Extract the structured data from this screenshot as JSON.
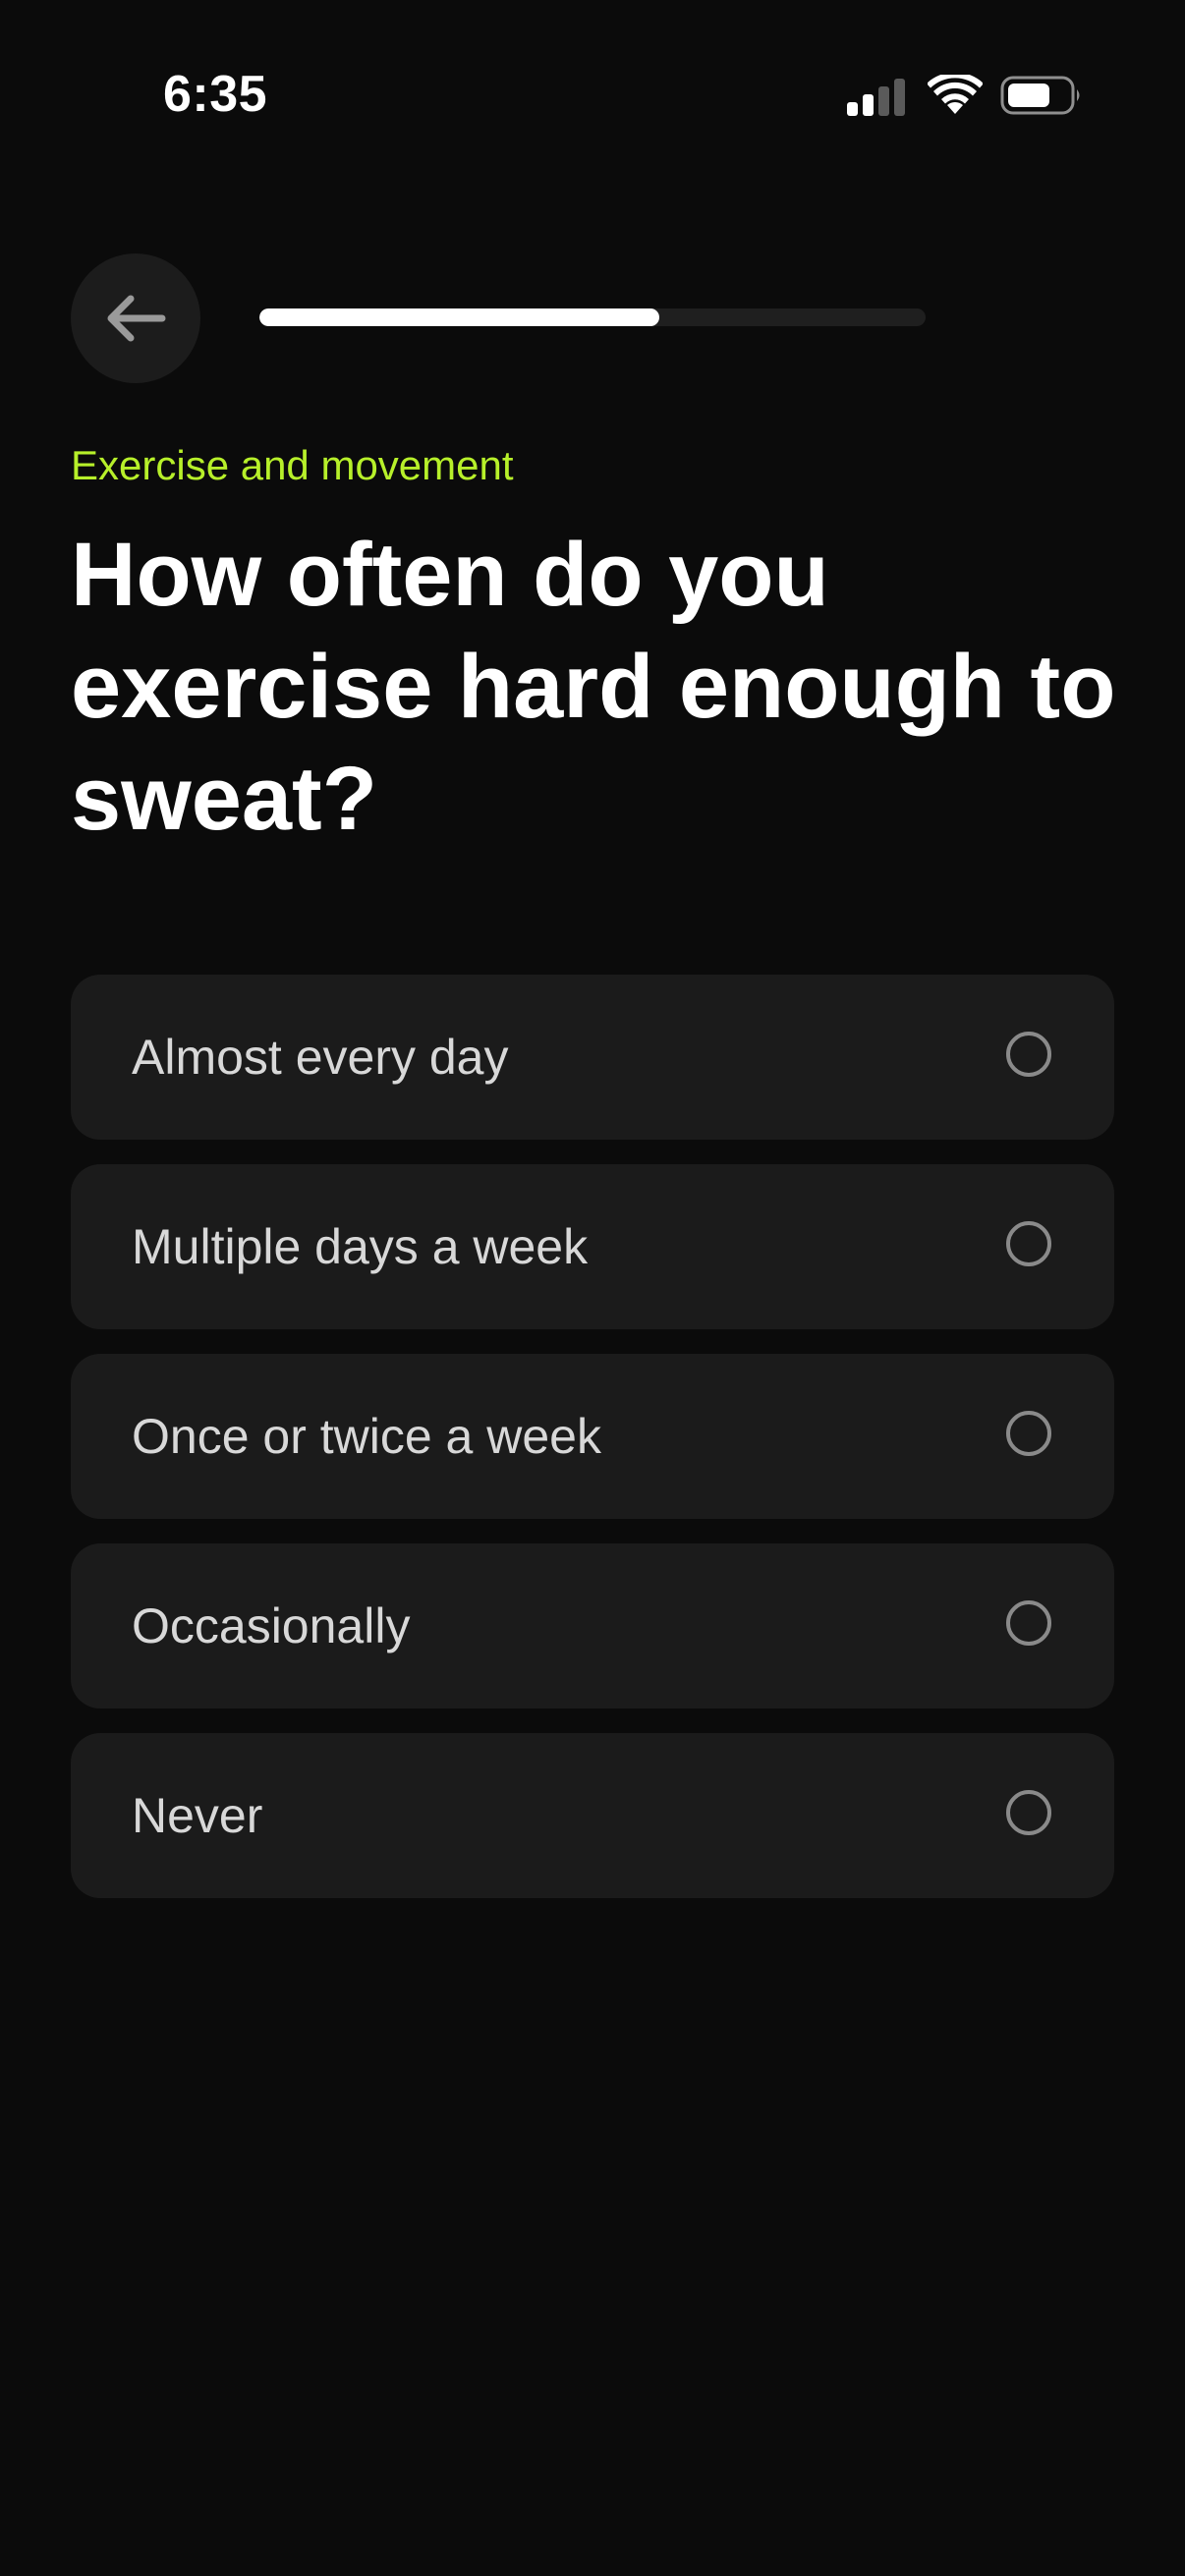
{
  "status_bar": {
    "time": "6:35",
    "icons": [
      "cellular-signal-icon",
      "wifi-icon",
      "battery-icon"
    ]
  },
  "header": {
    "back_icon": "arrow-left-icon",
    "progress": 0.6
  },
  "question": {
    "category": "Exercise and movement",
    "title": "How often do you exercise hard enough to sweat?"
  },
  "options": [
    {
      "label": "Almost every day",
      "selected": false
    },
    {
      "label": "Multiple days a week",
      "selected": false
    },
    {
      "label": "Once or twice a week",
      "selected": false
    },
    {
      "label": "Occasionally",
      "selected": false
    },
    {
      "label": "Never",
      "selected": false
    }
  ],
  "colors": {
    "background": "#0b0b0b",
    "accent": "#b7f02a",
    "card": "#1b1b1b",
    "progress_track": "#1f1f1f",
    "progress_fill": "#ffffff"
  }
}
